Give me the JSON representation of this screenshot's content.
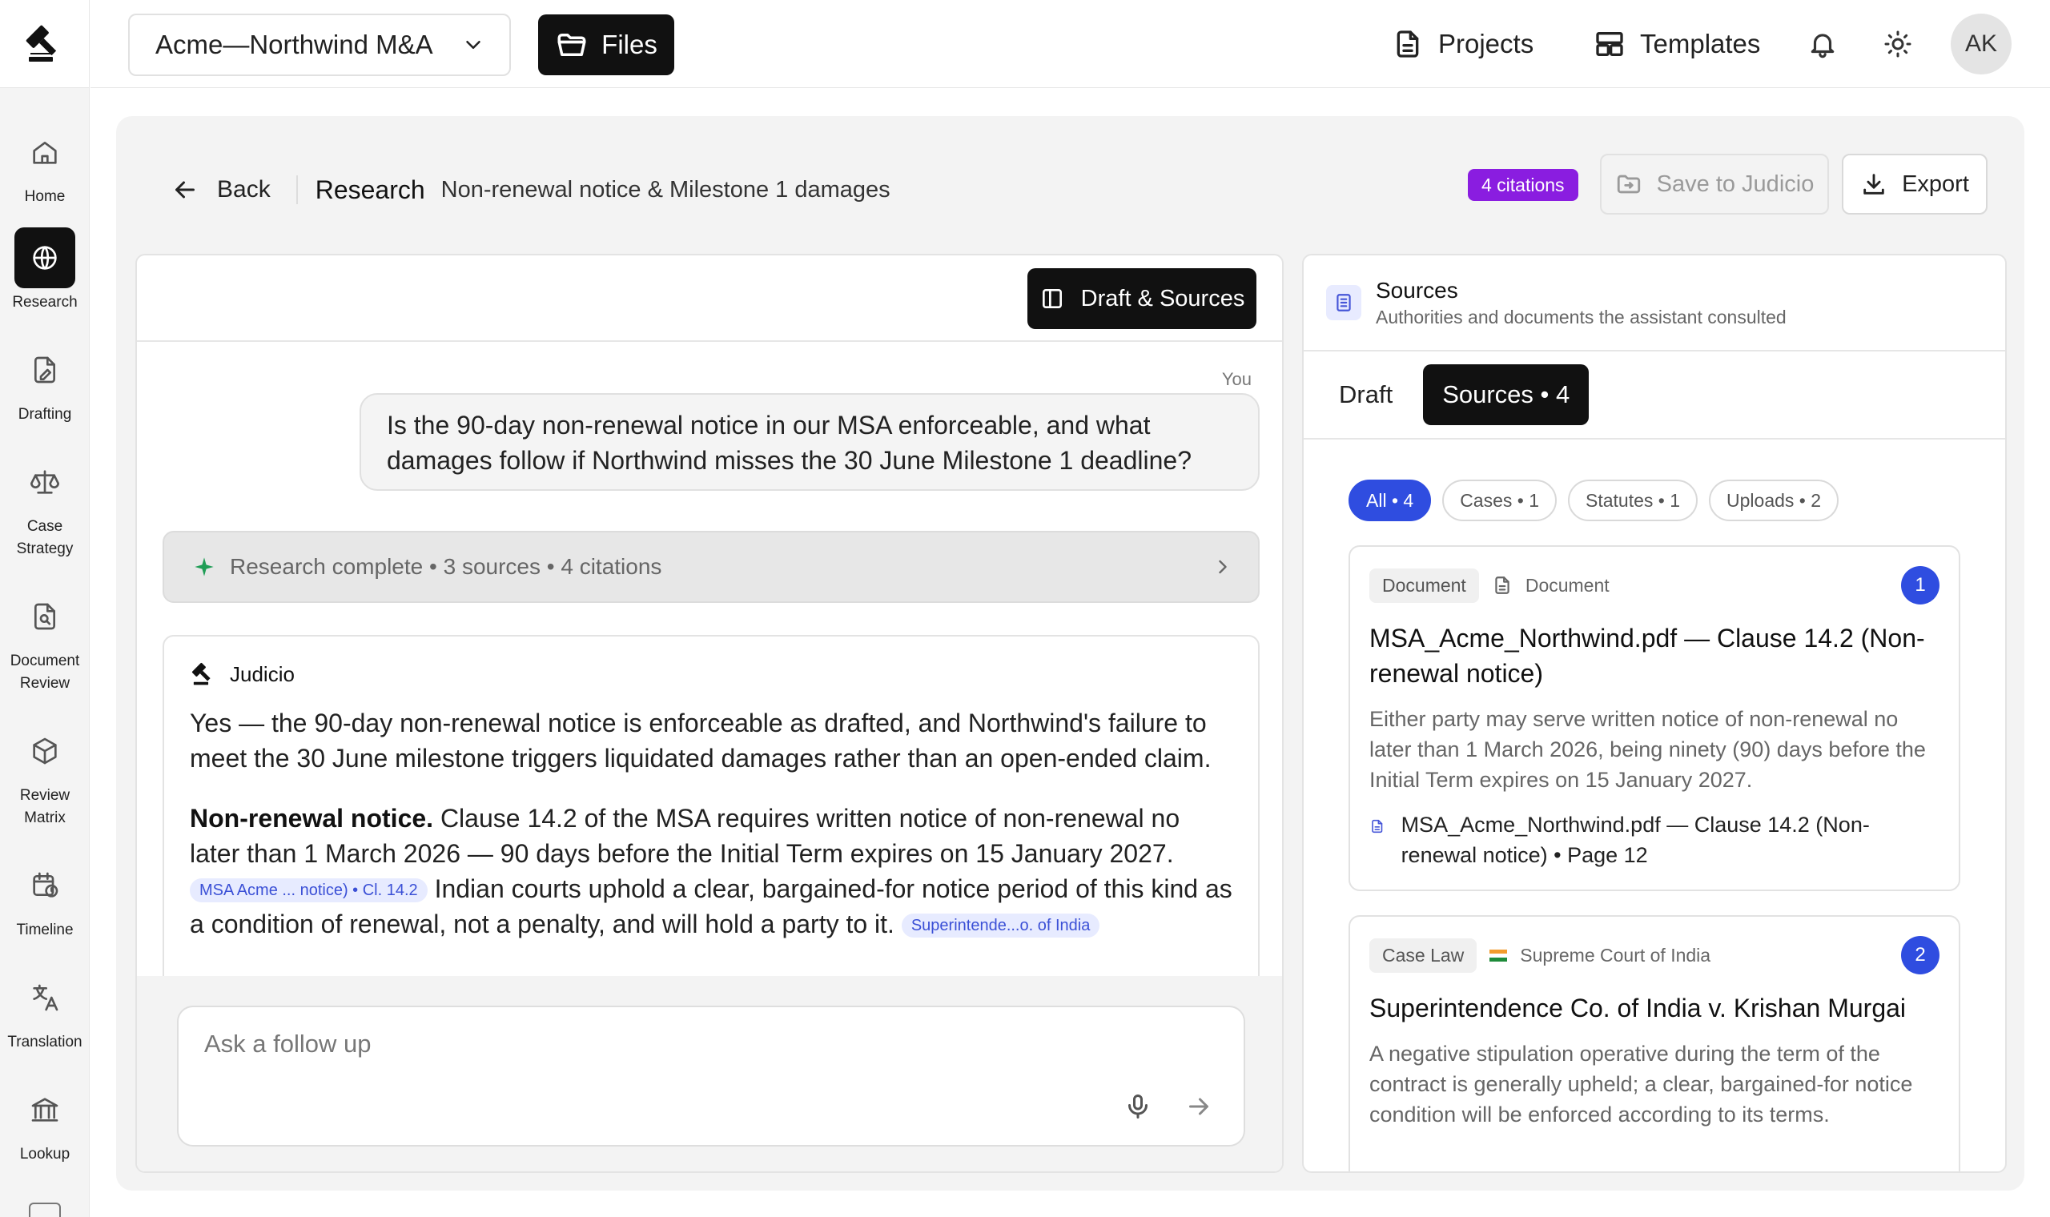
{
  "app": {
    "project_name": "Acme—Northwind M&A",
    "files_label": "Files",
    "top_links": {
      "projects": "Projects",
      "templates": "Templates"
    },
    "avatar_initials": "AK"
  },
  "nav": {
    "home": "Home",
    "research": "Research",
    "drafting": "Drafting",
    "case_strategy": "Case Strategy",
    "document_review": "Document Review",
    "review_matrix": "Review Matrix",
    "timeline": "Timeline",
    "translation": "Translation",
    "lookup": "Lookup"
  },
  "header": {
    "back_label": "Back",
    "section": "Research",
    "subtitle": "Non-renewal notice & Milestone 1 damages",
    "citations_badge": "4 citations",
    "save_label": "Save to Judicio",
    "export_label": "Export"
  },
  "chat": {
    "draft_sources_label": "Draft & Sources",
    "you_label": "You",
    "user_message": "Is the 90-day non-renewal notice in our MSA enforceable, and what damages follow if Northwind misses the 30 June Milestone 1 deadline?",
    "status_text": "Research complete • 3 sources • 4 citations",
    "assistant_name": "Judicio",
    "answer_intro": "Yes — the 90-day non-renewal notice is enforceable as drafted, and Northwind's failure to meet the 30 June milestone triggers liquidated damages rather than an open-ended claim.",
    "answer_heading": "Non-renewal notice.",
    "answer_body_1": "Clause 14.2 of the MSA requires written notice of non-renewal no later than 1 March 2026 — 90 days before the Initial Term expires on 15 January 2027.",
    "citation_1": "MSA Acme ... notice) • Cl. 14.2",
    "answer_body_2": "Indian courts uphold a clear, bargained-for notice period of this kind as a condition of renewal, not a penalty, and will hold a party to it.",
    "citation_2": "Superintende...o. of India",
    "followup_placeholder": "Ask a follow up"
  },
  "sources_panel": {
    "title": "Sources",
    "subtitle": "Authorities and documents the assistant consulted",
    "tab_draft": "Draft",
    "tab_sources": "Sources • 4",
    "filters": [
      "All • 4",
      "Cases • 1",
      "Statutes • 1",
      "Uploads • 2"
    ],
    "cards": [
      {
        "tag": "Document",
        "type": "Document",
        "number": "1",
        "title": "MSA_Acme_Northwind.pdf — Clause 14.2 (Non-renewal notice)",
        "excerpt": "Either party may serve written notice of non-renewal no later than 1 March 2026, being ninety (90) days before the Initial Term expires on 15 January 2027.",
        "ref": "MSA_Acme_Northwind.pdf — Clause 14.2 (Non-renewal notice) • Page 12"
      },
      {
        "tag": "Case Law",
        "type": "Supreme Court of India",
        "number": "2",
        "title": "Superintendence Co. of India v. Krishan Murgai",
        "excerpt": "A negative stipulation operative during the term of the contract is generally upheld; a clear, bargained-for notice condition will be enforced according to its terms."
      }
    ]
  },
  "colors": {
    "accent_blue": "#2f4de0",
    "citation_badge": "#8a1de0",
    "dark_button": "#111111"
  }
}
